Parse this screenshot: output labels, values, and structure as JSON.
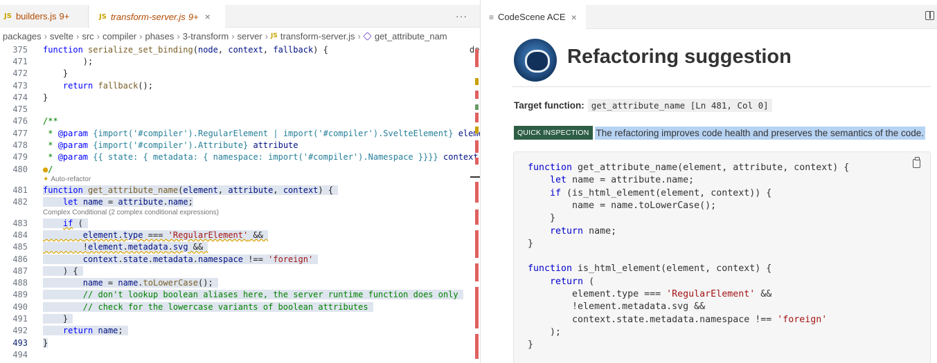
{
  "editor": {
    "tabs": [
      {
        "badge": "JS",
        "name": "builders.js",
        "count": "9+"
      },
      {
        "badge": "JS",
        "name": "transform-server.js",
        "count": "9+",
        "close": "×"
      }
    ],
    "more_actions": "···",
    "breadcrumb": [
      "packages",
      "svelte",
      "src",
      "compiler",
      "phases",
      "3-transform",
      "server",
      "transform-server.js",
      "get_attribute_nam"
    ],
    "breadcrumb_badge": "JS",
    "overflow_fragment": "de",
    "lenses": {
      "auto_refactor": "Auto-refactor",
      "complex_conditional": "Complex Conditional (2 complex conditional expressions)"
    },
    "lines": [
      {
        "n": "375",
        "t": "function serialize_set_binding(node, context, fallback) {"
      },
      {
        "n": "471",
        "t": "        );"
      },
      {
        "n": "472",
        "t": "    }"
      },
      {
        "n": "473",
        "t": "    return fallback();"
      },
      {
        "n": "474",
        "t": "}"
      },
      {
        "n": "475",
        "t": ""
      },
      {
        "n": "476",
        "t": "/**"
      },
      {
        "n": "477",
        "t": " * @param {import('#compiler').RegularElement | import('#compiler').SvelteElement} element"
      },
      {
        "n": "478",
        "t": " * @param {import('#compiler').Attribute} attribute"
      },
      {
        "n": "479",
        "t": " * @param {{ state: { metadata: { namespace: import('#compiler').Namespace }}}} context"
      },
      {
        "n": "480",
        "t": " */"
      },
      {
        "n": "481",
        "t": "function get_attribute_name(element, attribute, context) {"
      },
      {
        "n": "482",
        "t": "    let name = attribute.name;"
      },
      {
        "n": "483",
        "t": "    if ("
      },
      {
        "n": "484",
        "t": "        element.type === 'RegularElement' &&"
      },
      {
        "n": "485",
        "t": "        !element.metadata.svg &&"
      },
      {
        "n": "486",
        "t": "        context.state.metadata.namespace !== 'foreign'"
      },
      {
        "n": "487",
        "t": "    ) {"
      },
      {
        "n": "488",
        "t": "        name = name.toLowerCase();"
      },
      {
        "n": "489",
        "t": "        // don't lookup boolean aliases here, the server runtime function does only"
      },
      {
        "n": "490",
        "t": "        // check for the lowercase variants of boolean attributes"
      },
      {
        "n": "491",
        "t": "    }"
      },
      {
        "n": "492",
        "t": "    return name;"
      },
      {
        "n": "493",
        "t": "}"
      },
      {
        "n": "494",
        "t": ""
      }
    ]
  },
  "panel": {
    "tab_label": "CodeScene ACE",
    "tab_close": "×",
    "title": "Refactoring suggestion",
    "target_label": "Target function:",
    "target_value": "get_attribute_name [Ln 481, Col 0]",
    "badge": "QUICK INSPECTION",
    "inspection_text": "The refactoring improves code health and preserves the semantics of the code.",
    "code_lines": [
      "function get_attribute_name(element, attribute, context) {",
      "    let name = attribute.name;",
      "    if (is_html_element(element, context)) {",
      "        name = name.toLowerCase();",
      "    }",
      "    return name;",
      "}",
      "",
      "function is_html_element(element, context) {",
      "    return (",
      "        element.type === 'RegularElement' &&",
      "        !element.metadata.svg &&",
      "        context.state.metadata.namespace !== 'foreign'",
      "    );",
      "}"
    ]
  },
  "colors": {
    "badge_bg": "#2e5e45",
    "inspection_highlight": "#b7d3f3",
    "keyword": "#0000ff",
    "string": "#a31515",
    "comment": "#008000"
  }
}
